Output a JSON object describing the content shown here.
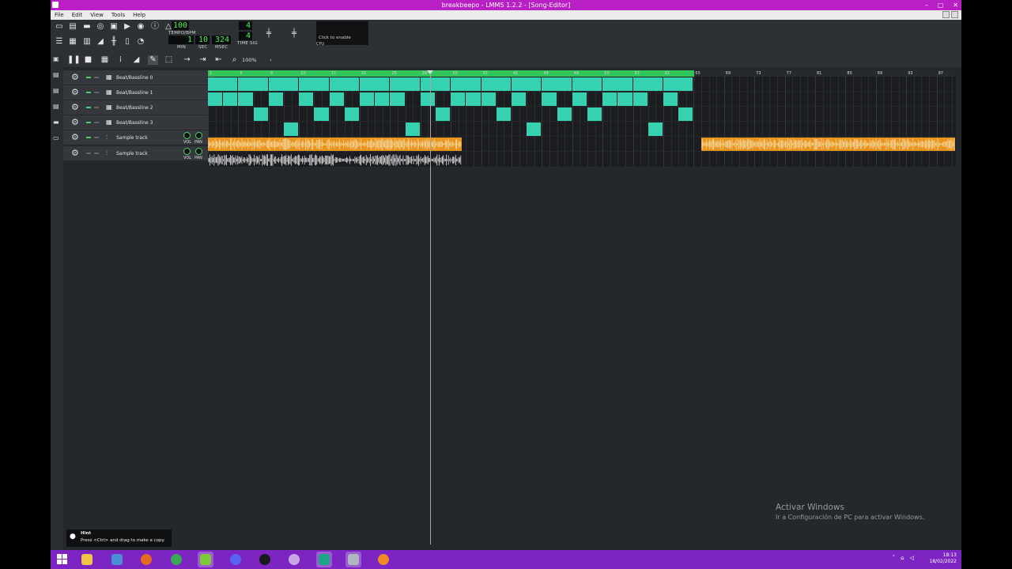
{
  "window": {
    "title": "breakbeepo - LMMS 1.2.2 - [Song-Editor]",
    "buttons": [
      "–",
      "▢",
      "✕"
    ]
  },
  "menu": {
    "items": [
      "File",
      "Edit",
      "View",
      "Tools",
      "Help"
    ]
  },
  "toolbar": {
    "tempo_value": "100",
    "tempo_label": "TEMPO/BPM",
    "time_min": "1",
    "time_sec": "10",
    "time_msec": "324",
    "min_label": "MIN",
    "sec_label": "SEC",
    "msec_label": "MSEC",
    "timesig_top": "4",
    "timesig_bottom": "4",
    "timesig_label": "TIME SIG",
    "cpu_hint": "Click to enable",
    "cpu_label": "CPU"
  },
  "songbar": {
    "zoom": "100%"
  },
  "ruler": {
    "ticks": [
      "1",
      "5",
      "9",
      "13",
      "17",
      "21",
      "25",
      "29",
      "33",
      "37",
      "41",
      "45",
      "49",
      "53",
      "57",
      "61",
      "65",
      "69",
      "73",
      "77",
      "81",
      "85",
      "89",
      "93",
      "97"
    ]
  },
  "tracks": [
    {
      "name": "Beat/Bassline 0",
      "type": "bb"
    },
    {
      "name": "Beat/Bassline 1",
      "type": "bb"
    },
    {
      "name": "Beat/Bassline 2",
      "type": "bb"
    },
    {
      "name": "Beat/Bassline 3",
      "type": "bb"
    },
    {
      "name": "Sample track",
      "type": "sample",
      "vol_label": "VOL",
      "pan_label": "PAN"
    },
    {
      "name": "Sample track",
      "type": "sample",
      "vol_label": "VOL",
      "pan_label": "PAN"
    }
  ],
  "hint": {
    "title": "Hint",
    "text": "Press <Ctrl> and drag to make a copy."
  },
  "watermark": {
    "line1": "Activar Windows",
    "line2": "Ir a Configuración de PC para activar Windows."
  },
  "tray": {
    "time": "18:13",
    "date": "18/02/2022"
  },
  "colors": {
    "title_bar": "#b81fc4",
    "taskbar": "#7d25c2",
    "pattern_block": "#36d1b0",
    "sample_clip": "#e8941d",
    "lcd_text": "#4cf25a",
    "ruler_played": "#32c65a"
  }
}
